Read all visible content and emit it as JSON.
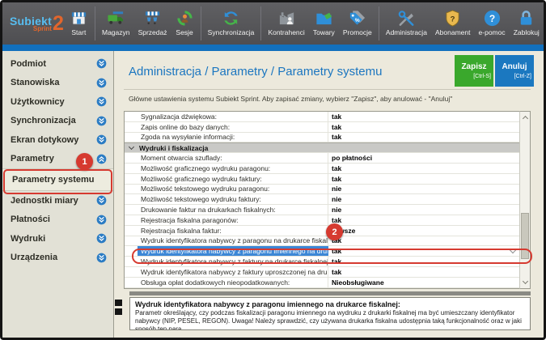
{
  "app_title": "Subiekt Sprint 2",
  "toolbar": {
    "logo": {
      "name": "Subiekt",
      "sub": "Sprint",
      "version": "2"
    },
    "items": [
      {
        "id": "start",
        "label": "Start",
        "icon": "storefront-icon",
        "separator_after": true
      },
      {
        "id": "magazyn",
        "label": "Magazyn",
        "icon": "warehouse-truck-icon",
        "separator_after": false
      },
      {
        "id": "sprzedaz",
        "label": "Sprzedaż",
        "icon": "store-carts-icon",
        "separator_after": false
      },
      {
        "id": "sesje",
        "label": "Sesje",
        "icon": "session-person-icon",
        "separator_after": true
      },
      {
        "id": "synchronizacja",
        "label": "Synchronizacja",
        "icon": "sync-arrows-icon",
        "separator_after": true
      },
      {
        "id": "kontrahenci",
        "label": "Kontrahenci",
        "icon": "factory-person-icon",
        "separator_after": false
      },
      {
        "id": "towary",
        "label": "Towary",
        "icon": "folder-icon",
        "separator_after": false
      },
      {
        "id": "promocje",
        "label": "Promocje",
        "icon": "price-tags-icon",
        "separator_after": true
      },
      {
        "id": "administracja",
        "label": "Administracja",
        "icon": "tools-icon",
        "separator_after": false
      },
      {
        "id": "abonament",
        "label": "Abonament",
        "icon": "shield-question-icon",
        "separator_after": false
      },
      {
        "id": "epomoc",
        "label": "e-pomoc",
        "icon": "help-circle-icon",
        "separator_after": false
      },
      {
        "id": "zablokuj",
        "label": "Zablokuj",
        "icon": "padlock-icon",
        "separator_after": false
      }
    ]
  },
  "sidebar": {
    "items": [
      {
        "id": "podmiot",
        "label": "Podmiot",
        "type": "item",
        "chevron": "down"
      },
      {
        "id": "stanowiska",
        "label": "Stanowiska",
        "type": "item",
        "chevron": "down"
      },
      {
        "id": "uzytkownicy",
        "label": "Użytkownicy",
        "type": "item",
        "chevron": "down"
      },
      {
        "id": "synchronizacja",
        "label": "Synchronizacja",
        "type": "item",
        "chevron": "down"
      },
      {
        "id": "ekran-dotykowy",
        "label": "Ekran dotykowy",
        "type": "item",
        "chevron": "down"
      },
      {
        "id": "parametry",
        "label": "Parametry",
        "type": "item",
        "chevron": "up"
      },
      {
        "id": "parametry-systemu",
        "label": "Parametry systemu",
        "type": "subitem",
        "chevron": null
      },
      {
        "id": "jednostki-miary",
        "label": "Jednostki miary",
        "type": "item",
        "chevron": "down"
      },
      {
        "id": "platnosci",
        "label": "Płatności",
        "type": "item",
        "chevron": "down"
      },
      {
        "id": "wydruki",
        "label": "Wydruki",
        "type": "item",
        "chevron": "down"
      },
      {
        "id": "urzadzenia",
        "label": "Urządzenia",
        "type": "item",
        "chevron": "down"
      }
    ]
  },
  "main": {
    "breadcrumb": "Administracja / Parametry / Parametry systemu",
    "buttons": [
      {
        "id": "zapisz",
        "label": "Zapisz",
        "shortcut": "[Ctrl-S]",
        "color": "#3aa82c"
      },
      {
        "id": "anuluj",
        "label": "Anuluj",
        "shortcut": "[Ctrl-Z]",
        "color": "#1b78c0"
      }
    ],
    "subtitle": "Główne ustawienia systemu Subiekt Sprint. Aby zapisać zmiany, wybierz \"Zapisz\", aby anulować - \"Anuluj\"",
    "table": {
      "rows": [
        {
          "type": "param",
          "label": "Sygnalizacja dźwiękowa:",
          "value": "tak"
        },
        {
          "type": "param",
          "label": "Zapis online do bazy danych:",
          "value": "tak"
        },
        {
          "type": "param",
          "label": "Zgoda na wysyłanie informacji:",
          "value": "tak"
        },
        {
          "type": "section",
          "label": "Wydruki i fiskalizacja"
        },
        {
          "type": "param",
          "label": "Moment otwarcia szuflady:",
          "value": "po płatności"
        },
        {
          "type": "param",
          "label": "Możliwość graficznego wydruku paragonu:",
          "value": "tak"
        },
        {
          "type": "param",
          "label": "Możliwość graficznego wydruku faktury:",
          "value": "tak"
        },
        {
          "type": "param",
          "label": "Możliwość tekstowego wydruku paragonu:",
          "value": "nie"
        },
        {
          "type": "param",
          "label": "Możliwość tekstowego wydruku faktury:",
          "value": "nie"
        },
        {
          "type": "param",
          "label": "Drukowanie faktur na drukarkach fiskalnych:",
          "value": "nie"
        },
        {
          "type": "param",
          "label": "Rejestracja fiskalna paragonów:",
          "value": "tak"
        },
        {
          "type": "param",
          "label": "Rejestracja fiskalna faktur:",
          "value": "zawsze"
        },
        {
          "type": "param",
          "label": "Wydruk identyfikatora nabywcy z paragonu na drukarce fiskalnej",
          "value": "tak"
        },
        {
          "type": "param",
          "label": "Wydruk identyfikatora nabywcy z paragonu imiennego na drukar",
          "value": "tak",
          "selected": true,
          "dropdown": true
        },
        {
          "type": "param",
          "label": "Wydruk identyfikatora nabywcy z faktury na drukarce fiskalnej:",
          "value": "tak"
        },
        {
          "type": "param",
          "label": "Wydruk identyfikatora nabywcy z faktury uproszczonej na drukar",
          "value": "tak"
        },
        {
          "type": "param",
          "label": "Obsługa opłat dodatkowych nieopodatkowanych:",
          "value": "Nieobsługiwane"
        }
      ]
    },
    "description": {
      "title": "Wydruk identyfikatora nabywcy z paragonu imiennego na drukarce fiskalnej:",
      "body": "Parametr określający, czy podczas fiskalizacji paragonu imiennego na wydruku z drukarki fiskalnej ma być umieszczany identyfikator nabywcy (NIP, PESEL, REGON). Uwaga! Należy sprawdzić, czy używana drukarka fiskalna udostępnia taką funkcjonalność oraz w jaki sposób ten para..."
    }
  },
  "annotations": {
    "step1": "1",
    "step2": "2"
  },
  "colors": {
    "accent_blue": "#1b76c0",
    "accent_green": "#3aa82c",
    "selected_row": "#3c87d6",
    "annotation_red": "#d63a30",
    "toolbar_bg": "#545457",
    "sidebar_bg": "#e2e1d6"
  }
}
